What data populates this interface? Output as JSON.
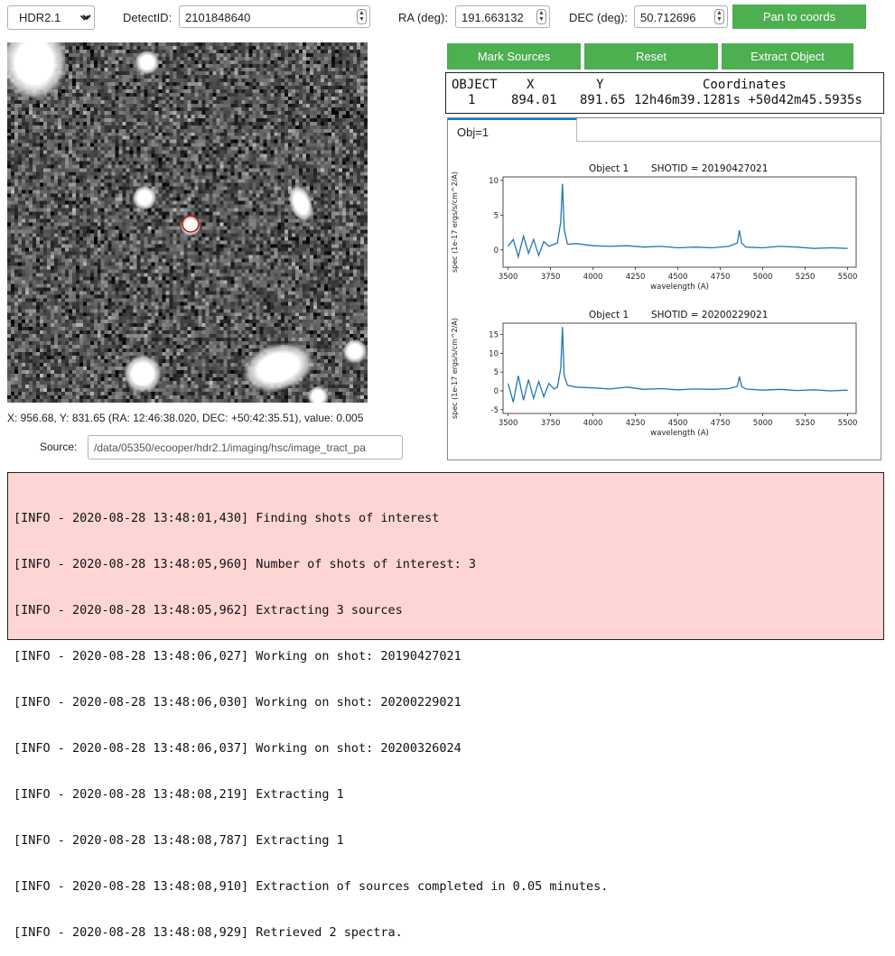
{
  "toolbar": {
    "survey_select": "HDR2.1",
    "detectid_label": "DetectID:",
    "detectid_value": "2101848640",
    "ra_label": "RA (deg):",
    "ra_value": "191.663132",
    "dec_label": "DEC (deg):",
    "dec_value": "50.712696",
    "pan_button": "Pan to coords"
  },
  "buttons": {
    "mark_sources": "Mark Sources",
    "reset": "Reset",
    "extract_object": "Extract Object"
  },
  "object_table": {
    "headers": [
      "OBJECT",
      "X",
      "Y",
      "Coordinates"
    ],
    "rows": [
      {
        "object": "1",
        "x": "894.01",
        "y": "891.65",
        "coordinates": "12h46m39.1281s +50d42m45.5935s"
      }
    ]
  },
  "image_panel": {
    "cursor_info": "X: 956.68, Y: 831.65 (RA: 12:46:38.020, DEC: +50:42:35.51), value: 0.005",
    "source_label": "Source:",
    "source_value": "/data/05350/ecooper/hdr2.1/imaging/hsc/image_tract_pa"
  },
  "tabs": [
    {
      "label": "Obj=1"
    }
  ],
  "colors": {
    "button_green": "#4caf50",
    "log_background": "#fdd5d5",
    "spectrum_line": "#1f77b4",
    "marker": "#cc0000"
  },
  "chart_data": [
    {
      "type": "line",
      "title_object": "Object 1",
      "title_shotid": "SHOTID = 20190427021",
      "xlabel": "wavelength (A)",
      "ylabel": "spec (1e-17 ergs/s/cm^2/A)",
      "xlim": [
        3470,
        5550
      ],
      "ylim": [
        -2.5,
        10.5
      ],
      "xticks": [
        3500,
        3750,
        4000,
        4250,
        4500,
        4750,
        5000,
        5250,
        5500
      ],
      "yticks": [
        0,
        5,
        10
      ],
      "x": [
        3500,
        3530,
        3560,
        3590,
        3620,
        3650,
        3680,
        3710,
        3740,
        3770,
        3790,
        3810,
        3820,
        3830,
        3850,
        3900,
        4000,
        4100,
        4200,
        4300,
        4400,
        4500,
        4600,
        4700,
        4800,
        4850,
        4862,
        4875,
        4900,
        5000,
        5100,
        5200,
        5300,
        5400,
        5500
      ],
      "y": [
        0.5,
        1.5,
        -1.0,
        2.0,
        -0.5,
        1.5,
        -0.8,
        1.2,
        0.5,
        0.8,
        1.0,
        4.0,
        9.5,
        3.0,
        0.8,
        0.9,
        0.6,
        0.5,
        0.6,
        0.4,
        0.5,
        0.3,
        0.4,
        0.3,
        0.5,
        1.0,
        2.8,
        1.0,
        0.4,
        0.3,
        0.5,
        0.4,
        0.2,
        0.3,
        0.2
      ]
    },
    {
      "type": "line",
      "title_object": "Object 1",
      "title_shotid": "SHOTID = 20200229021",
      "xlabel": "wavelength (A)",
      "ylabel": "spec (1e-17 ergs/s/cm^2/A)",
      "xlim": [
        3470,
        5550
      ],
      "ylim": [
        -6,
        18
      ],
      "xticks": [
        3500,
        3750,
        4000,
        4250,
        4500,
        4750,
        5000,
        5250,
        5500
      ],
      "yticks": [
        -5,
        0,
        5,
        10,
        15
      ],
      "x": [
        3500,
        3530,
        3560,
        3590,
        3620,
        3650,
        3680,
        3710,
        3740,
        3770,
        3790,
        3810,
        3820,
        3830,
        3850,
        3900,
        4000,
        4100,
        4200,
        4300,
        4400,
        4500,
        4600,
        4700,
        4800,
        4850,
        4862,
        4875,
        4900,
        5000,
        5100,
        5200,
        5300,
        5400,
        5500
      ],
      "y": [
        2.0,
        -3.0,
        4.0,
        -2.5,
        3.0,
        -2.0,
        2.5,
        -1.5,
        2.0,
        0.5,
        1.0,
        6.0,
        17.0,
        4.0,
        1.5,
        1.0,
        0.8,
        0.5,
        1.0,
        0.4,
        0.6,
        0.3,
        0.5,
        0.4,
        0.6,
        1.2,
        3.8,
        1.2,
        0.5,
        0.2,
        0.4,
        0.1,
        0.3,
        0.0,
        0.2
      ]
    }
  ],
  "log": {
    "lines": [
      "[INFO - 2020-08-28 13:48:01,430] Finding shots of interest",
      "[INFO - 2020-08-28 13:48:05,960] Number of shots of interest: 3",
      "[INFO - 2020-08-28 13:48:05,962] Extracting 3 sources",
      "[INFO - 2020-08-28 13:48:06,027] Working on shot: 20190427021",
      "[INFO - 2020-08-28 13:48:06,030] Working on shot: 20200229021",
      "[INFO - 2020-08-28 13:48:06,037] Working on shot: 20200326024",
      "[INFO - 2020-08-28 13:48:08,219] Extracting 1",
      "[INFO - 2020-08-28 13:48:08,787] Extracting 1",
      "[INFO - 2020-08-28 13:48:08,910] Extraction of sources completed in 0.05 minutes.",
      "[INFO - 2020-08-28 13:48:08,929] Retrieved 2 spectra."
    ]
  }
}
